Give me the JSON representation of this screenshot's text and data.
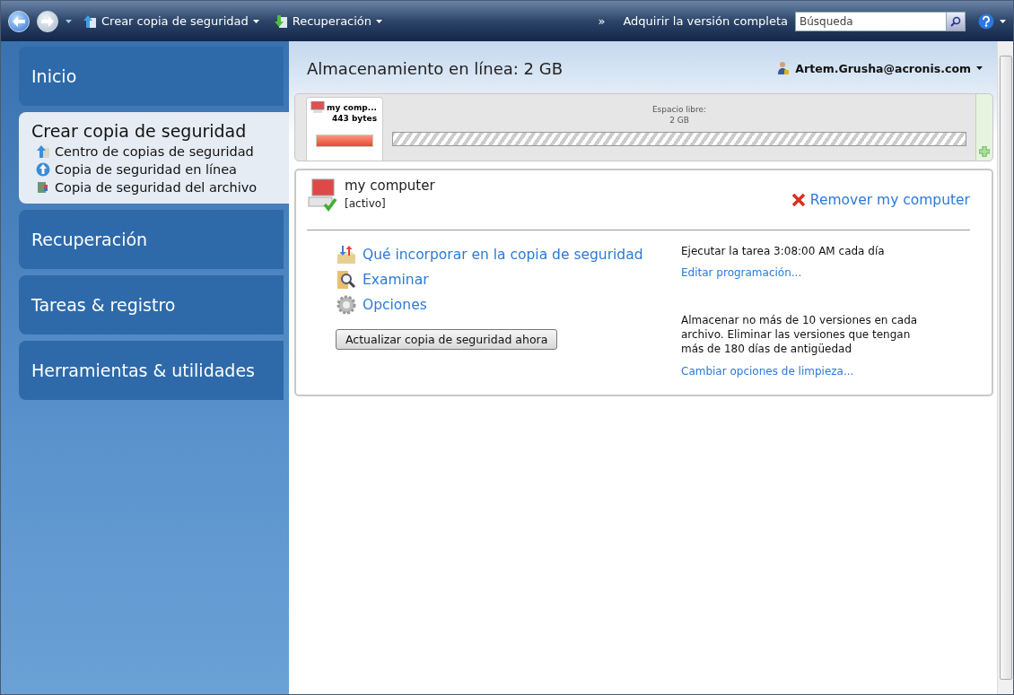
{
  "toolbar": {
    "menus": [
      {
        "label": "Crear copia de seguridad",
        "kind": "backup"
      },
      {
        "label": "Recuperación",
        "kind": "recovery"
      }
    ],
    "overflow": "»",
    "upgrade_link": "Adquirir la versión completa",
    "search": {
      "placeholder": "Búsqueda"
    }
  },
  "sidebar": {
    "sections": [
      {
        "label": "Inicio",
        "selected": false
      },
      {
        "label": "Crear copia de seguridad",
        "selected": true,
        "items": [
          {
            "label": "Centro de copias de seguridad",
            "kind": "center"
          },
          {
            "label": "Copia de seguridad en línea",
            "kind": "online"
          },
          {
            "label": "Copia de seguridad del archivo",
            "kind": "file"
          }
        ]
      },
      {
        "label": "Recuperación",
        "selected": false
      },
      {
        "label": "Tareas & registro",
        "selected": false
      },
      {
        "label": "Herramientas & utilidades",
        "selected": false
      }
    ]
  },
  "main": {
    "title": "Almacenamiento en línea: 2 GB",
    "account": "Artem.Grusha@acronis.com",
    "storage": {
      "device_name": "my comp...",
      "device_size": "443 bytes",
      "free_label": "Espacio libre:",
      "free_value": "2 GB"
    },
    "device": {
      "name": "my computer",
      "status": "[activo]",
      "remove_link": "Remover my computer",
      "actions": [
        {
          "label": "Qué incorporar en la copia de seguridad",
          "kind": "select"
        },
        {
          "label": "Examinar",
          "kind": "browse"
        },
        {
          "label": "Opciones",
          "kind": "options"
        }
      ],
      "button": "Actualizar copia de seguridad ahora",
      "schedule": "Ejecutar la tarea 3:08:00 AM cada día",
      "schedule_link": "Editar programación...",
      "retention": "Almacenar no más de 10 versiones en cada archivo. Eliminar las versiones que tengan más de 180 días de antigüedad",
      "retention_link": "Cambiar opciones de limpieza..."
    }
  }
}
